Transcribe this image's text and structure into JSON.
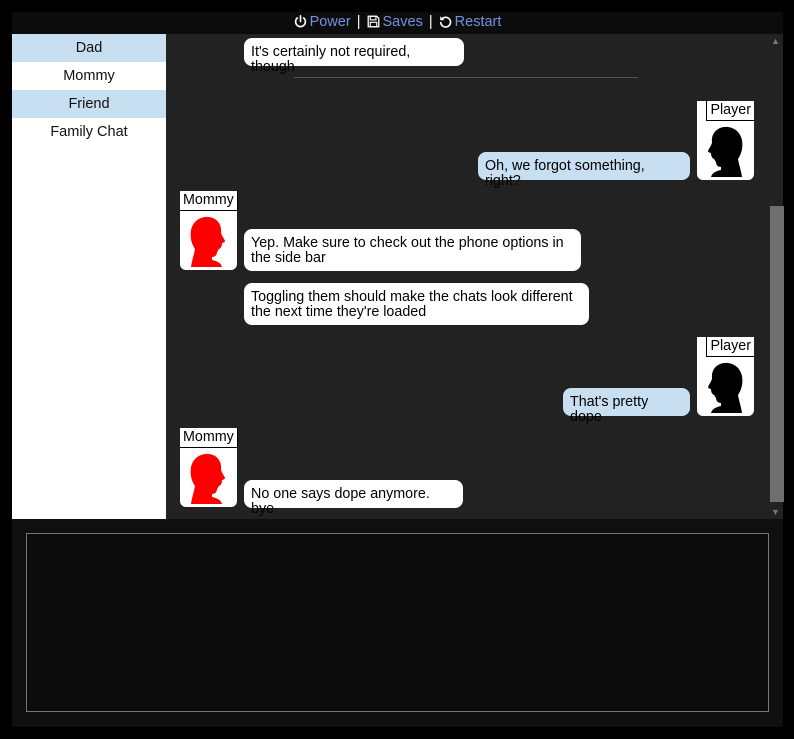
{
  "topbar": {
    "power_label": "Power",
    "saves_label": "Saves",
    "restart_label": "Restart",
    "separator": "|"
  },
  "sidebar": {
    "items": [
      {
        "label": "Dad",
        "highlighted": true
      },
      {
        "label": "Mommy",
        "highlighted": false
      },
      {
        "label": "Friend",
        "highlighted": true
      },
      {
        "label": "Family Chat",
        "highlighted": false
      }
    ]
  },
  "chat": {
    "messages": [
      {
        "sender": "Mommy",
        "text": "It's certainly not required, though"
      },
      {
        "sender": "Player",
        "text": "Oh, we forgot something, right?"
      },
      {
        "sender": "Mommy",
        "text": "Yep. Make sure to check out the phone options in the side bar"
      },
      {
        "sender": "Mommy",
        "text": "Toggling them should make the chats look different the next time they're loaded"
      },
      {
        "sender": "Player",
        "text": "That's pretty dope"
      },
      {
        "sender": "Mommy",
        "text": "No one says dope anymore. bye"
      }
    ],
    "avatars": [
      {
        "name": "Player",
        "color": "#000000"
      },
      {
        "name": "Mommy",
        "color": "#ff0000"
      },
      {
        "name": "Player",
        "color": "#000000"
      },
      {
        "name": "Mommy",
        "color": "#ff0000"
      }
    ]
  },
  "colors": {
    "accent_link": "#6f93e0",
    "highlight": "#c7dff1",
    "chat_bg": "#222222"
  },
  "icons": {
    "power": "power-icon",
    "saves": "floppy-disk-icon",
    "restart": "restart-icon"
  }
}
